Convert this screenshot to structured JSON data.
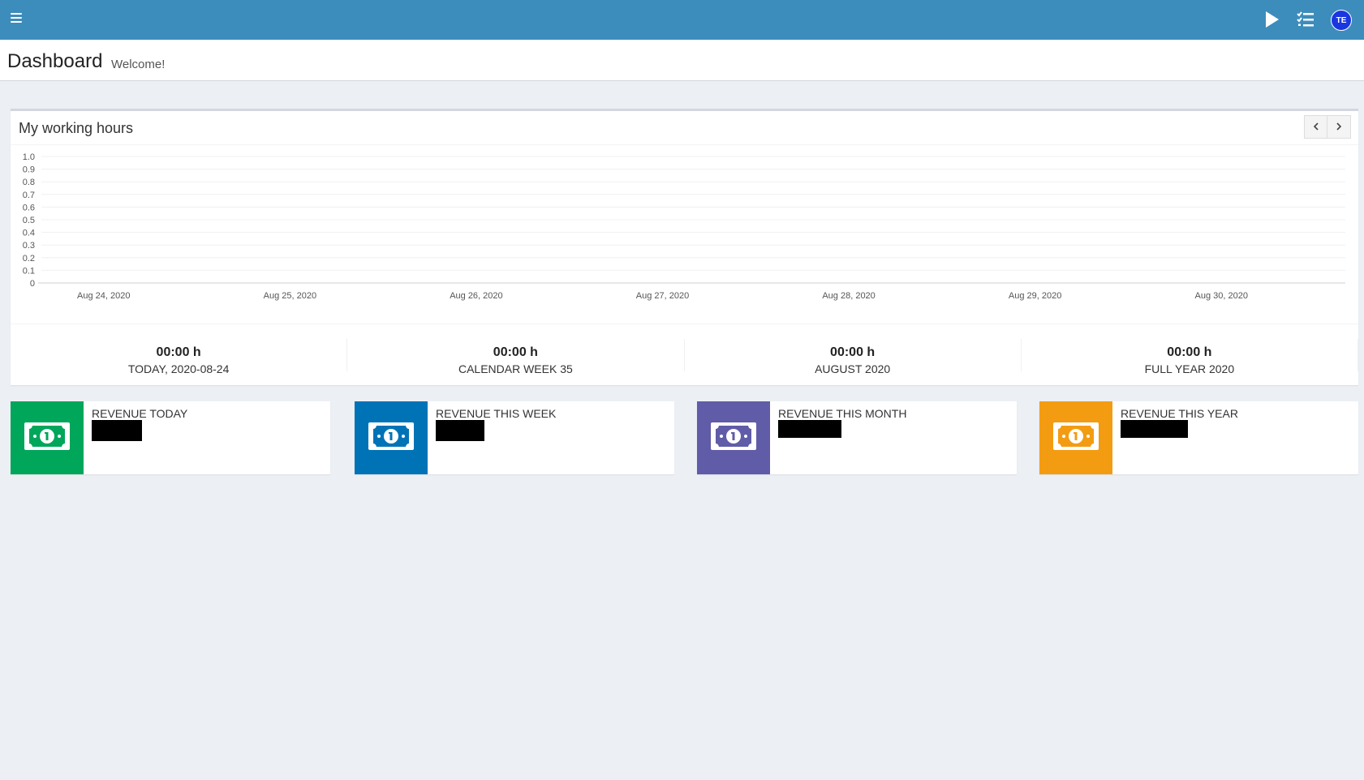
{
  "topbar": {
    "menu_icon": "hamburger-icon",
    "play_icon": "play-icon",
    "tasks_icon": "checklist-icon",
    "avatar_initials": "TE",
    "color": "#3c8dbc"
  },
  "header": {
    "title": "Dashboard",
    "subtitle": "Welcome!"
  },
  "working_hours": {
    "title": "My working hours",
    "prev_icon": "chevron-left-icon",
    "next_icon": "chevron-right-icon"
  },
  "chart_data": {
    "type": "bar",
    "categories": [
      "Aug 24, 2020",
      "Aug 25, 2020",
      "Aug 26, 2020",
      "Aug 27, 2020",
      "Aug 28, 2020",
      "Aug 29, 2020",
      "Aug 30, 2020"
    ],
    "values": [
      0,
      0,
      0,
      0,
      0,
      0,
      0
    ],
    "ylim": [
      0,
      1.0
    ],
    "yticks": [
      "1.0",
      "0.9",
      "0.8",
      "0.7",
      "0.6",
      "0.5",
      "0.4",
      "0.3",
      "0.2",
      "0.1",
      "0"
    ],
    "grid": true
  },
  "stats": [
    {
      "value": "00:00 h",
      "label": "TODAY, 2020-08-24"
    },
    {
      "value": "00:00 h",
      "label": "CALENDAR WEEK 35"
    },
    {
      "value": "00:00 h",
      "label": "AUGUST 2020"
    },
    {
      "value": "00:00 h",
      "label": "FULL YEAR 2020"
    }
  ],
  "revenue": [
    {
      "label": "REVENUE TODAY",
      "color": "#00a65a",
      "icon": "money-bill-icon"
    },
    {
      "label": "REVENUE THIS WEEK",
      "color": "#0073b7",
      "icon": "money-bill-icon"
    },
    {
      "label": "REVENUE THIS MONTH",
      "color": "#605ca8",
      "icon": "money-bill-icon"
    },
    {
      "label": "REVENUE THIS YEAR",
      "color": "#f39c12",
      "icon": "money-bill-icon"
    }
  ]
}
